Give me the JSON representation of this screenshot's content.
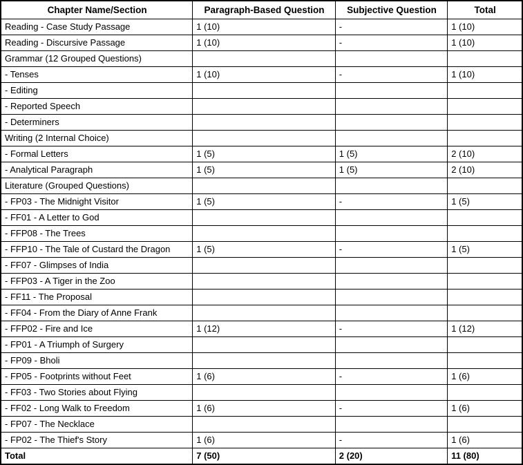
{
  "table": {
    "columns": [
      "Chapter Name/Section",
      "Paragraph-Based Question",
      "Subjective Question",
      "Total"
    ],
    "rows": [
      {
        "chapter": "Reading - Case Study Passage",
        "paragraph": "1 (10)",
        "subjective": "-",
        "total": "1 (10)"
      },
      {
        "chapter": "Reading - Discursive Passage",
        "paragraph": "1 (10)",
        "subjective": "-",
        "total": "1 (10)"
      },
      {
        "chapter": "Grammar (12 Grouped Questions)",
        "paragraph": "",
        "subjective": "",
        "total": ""
      },
      {
        "chapter": "- Tenses",
        "paragraph": "1 (10)",
        "subjective": "-",
        "total": "1 (10)"
      },
      {
        "chapter": "- Editing",
        "paragraph": "",
        "subjective": "",
        "total": ""
      },
      {
        "chapter": "- Reported Speech",
        "paragraph": "",
        "subjective": "",
        "total": ""
      },
      {
        "chapter": "- Determiners",
        "paragraph": "",
        "subjective": "",
        "total": ""
      },
      {
        "chapter": "Writing (2 Internal Choice)",
        "paragraph": "",
        "subjective": "",
        "total": ""
      },
      {
        "chapter": "- Formal Letters",
        "paragraph": "1 (5)",
        "subjective": "1 (5)",
        "total": "2 (10)"
      },
      {
        "chapter": "- Analytical Paragraph",
        "paragraph": "1 (5)",
        "subjective": "1 (5)",
        "total": "2 (10)"
      },
      {
        "chapter": "Literature (Grouped Questions)",
        "paragraph": "",
        "subjective": "",
        "total": ""
      },
      {
        "chapter": "- FP03 - The Midnight Visitor",
        "paragraph": "1 (5)",
        "subjective": "-",
        "total": "1 (5)"
      },
      {
        "chapter": "- FF01 - A Letter to God",
        "paragraph": "",
        "subjective": "",
        "total": ""
      },
      {
        "chapter": "- FFP08 - The Trees",
        "paragraph": "",
        "subjective": "",
        "total": ""
      },
      {
        "chapter": "- FFP10 - The Tale of Custard the Dragon",
        "paragraph": "1 (5)",
        "subjective": "-",
        "total": "1 (5)"
      },
      {
        "chapter": "- FF07 - Glimpses of India",
        "paragraph": "",
        "subjective": "",
        "total": ""
      },
      {
        "chapter": "- FFP03 - A Tiger in the Zoo",
        "paragraph": "",
        "subjective": "",
        "total": ""
      },
      {
        "chapter": "- FF11 - The Proposal",
        "paragraph": "",
        "subjective": "",
        "total": ""
      },
      {
        "chapter": "- FF04 - From the Diary of Anne Frank",
        "paragraph": "",
        "subjective": "",
        "total": ""
      },
      {
        "chapter": "- FFP02 - Fire and Ice",
        "paragraph": "1 (12)",
        "subjective": "-",
        "total": "1 (12)"
      },
      {
        "chapter": "- FP01 - A Triumph of Surgery",
        "paragraph": "",
        "subjective": "",
        "total": ""
      },
      {
        "chapter": "- FP09 - Bholi",
        "paragraph": "",
        "subjective": "",
        "total": ""
      },
      {
        "chapter": "- FP05 - Footprints without Feet",
        "paragraph": "1 (6)",
        "subjective": "-",
        "total": "1 (6)"
      },
      {
        "chapter": "- FF03 - Two Stories about Flying",
        "paragraph": "",
        "subjective": "",
        "total": ""
      },
      {
        "chapter": "- FF02 - Long Walk to Freedom",
        "paragraph": "1 (6)",
        "subjective": "-",
        "total": "1 (6)"
      },
      {
        "chapter": "- FP07 - The Necklace",
        "paragraph": "",
        "subjective": "",
        "total": ""
      },
      {
        "chapter": "- FP02 - The Thief's Story",
        "paragraph": "1 (6)",
        "subjective": "-",
        "total": "1 (6)"
      }
    ],
    "total_row": {
      "chapter": "Total",
      "paragraph": "7 (50)",
      "subjective": "2 (20)",
      "total": "11 (80)"
    }
  }
}
